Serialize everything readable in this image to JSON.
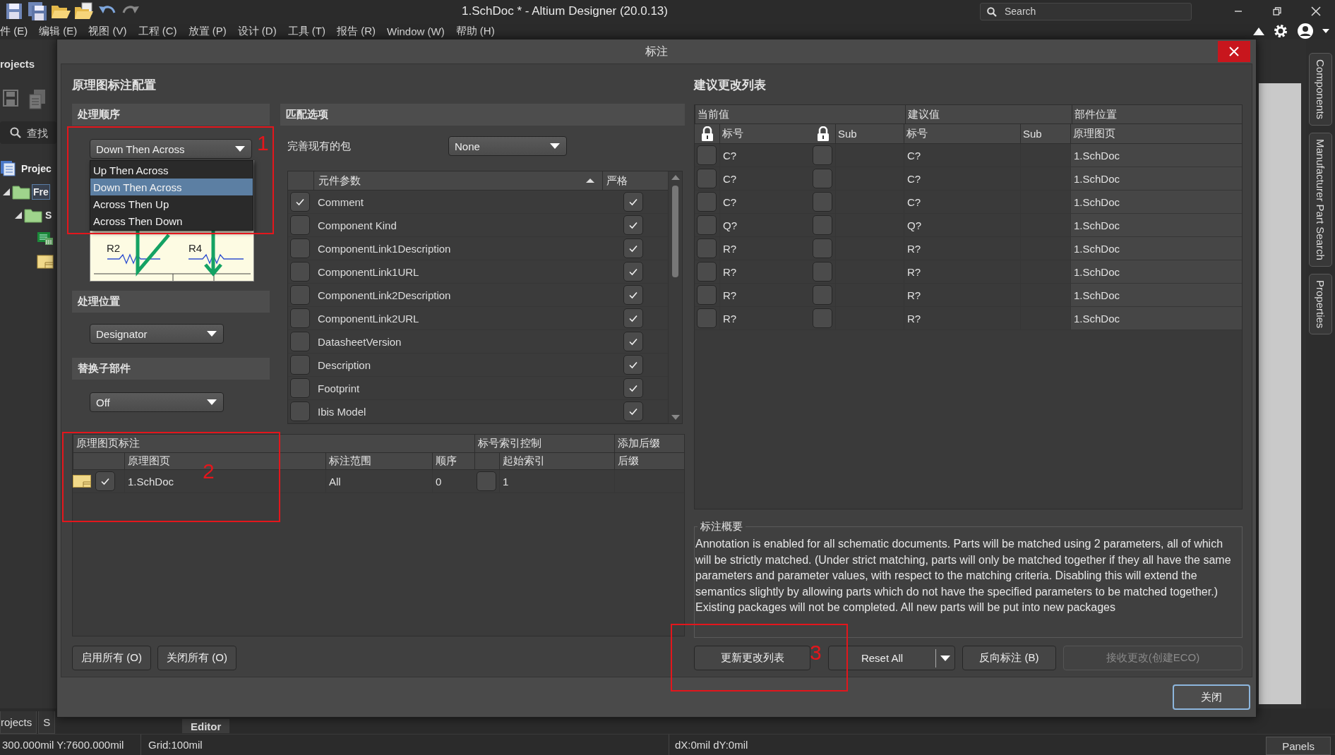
{
  "window": {
    "title": "1.SchDoc * - Altium Designer (20.0.13)",
    "search": {
      "placeholder": "Search"
    }
  },
  "menu": [
    "件 (E)",
    "编辑 (E)",
    "视图 (V)",
    "工程 (C)",
    "放置 (P)",
    "设计 (D)",
    "工具 (T)",
    "报告 (R)",
    "Window (W)",
    "帮助 (H)"
  ],
  "projects_panel": {
    "title": "rojects",
    "search": {
      "placeholder": "查找"
    },
    "tree": [
      {
        "kind": "project",
        "label": "Projec",
        "selected": false,
        "children": [
          {
            "kind": "folder",
            "label": "Fre",
            "selected": true,
            "expanded": true,
            "children": [
              {
                "kind": "folder",
                "label": "S",
                "selected": false,
                "expanded": true,
                "children": [
                  {
                    "kind": "pcb_document",
                    "selected": false
                  },
                  {
                    "kind": "schematic_document",
                    "selected": false
                  }
                ]
              }
            ]
          }
        ]
      }
    ]
  },
  "dialog": {
    "title": "标注",
    "config": {
      "title": "原理图标注配置",
      "order": {
        "title": "处理顺序",
        "value": "Down Then Across",
        "options": [
          {
            "label": "Up Then Across",
            "selected": false
          },
          {
            "label": "Down Then Across",
            "selected": true
          },
          {
            "label": "Across Then Up",
            "selected": false
          },
          {
            "label": "Across Then Down",
            "selected": false
          }
        ],
        "preview": {
          "labels": [
            "R2",
            "R4"
          ]
        }
      },
      "location": {
        "title": "处理位置",
        "value": "Designator"
      },
      "replace": {
        "title": "替换子部件",
        "value": "Off"
      }
    },
    "matching": {
      "title": "匹配选项",
      "complete_label": "完善现有的包",
      "complete_value": "None",
      "columns": [
        "元件参数",
        "严格"
      ],
      "rows": [
        {
          "name": "Comment",
          "checked": true,
          "strict": true
        },
        {
          "name": "Component Kind",
          "checked": false,
          "strict": true
        },
        {
          "name": "ComponentLink1Description",
          "checked": false,
          "strict": true
        },
        {
          "name": "ComponentLink1URL",
          "checked": false,
          "strict": true
        },
        {
          "name": "ComponentLink2Description",
          "checked": false,
          "strict": true
        },
        {
          "name": "ComponentLink2URL",
          "checked": false,
          "strict": true
        },
        {
          "name": "DatasheetVersion",
          "checked": false,
          "strict": true
        },
        {
          "name": "Description",
          "checked": false,
          "strict": true
        },
        {
          "name": "Footprint",
          "checked": false,
          "strict": true
        },
        {
          "name": "Ibis Model",
          "checked": false,
          "strict": true
        }
      ]
    },
    "sheets": {
      "group_headers": [
        "原理图页标注",
        "标号索引控制",
        "添加后缀"
      ],
      "columns": [
        "原理图页",
        "标注范围",
        "顺序",
        "起始索引",
        "后缀"
      ],
      "rows": [
        {
          "enabled": true,
          "sheet": "1.SchDoc",
          "scope": "All",
          "order": "0",
          "index_enabled": false,
          "start_index": "1"
        }
      ]
    },
    "left_buttons": [
      "启用所有 (O)",
      "关闭所有 (O)"
    ],
    "proposed": {
      "title": "建议更改列表",
      "group_headers": [
        "当前值",
        "建议值",
        "部件位置"
      ],
      "columns": [
        "标号",
        "Sub",
        "标号",
        "Sub",
        "原理图页"
      ],
      "rows": [
        {
          "current": "C?",
          "locked": false,
          "sub_locked": false,
          "proposed": "C?",
          "sheet": "1.SchDoc"
        },
        {
          "current": "C?",
          "locked": false,
          "sub_locked": false,
          "proposed": "C?",
          "sheet": "1.SchDoc"
        },
        {
          "current": "C?",
          "locked": false,
          "sub_locked": false,
          "proposed": "C?",
          "sheet": "1.SchDoc"
        },
        {
          "current": "Q?",
          "locked": false,
          "sub_locked": false,
          "proposed": "Q?",
          "sheet": "1.SchDoc"
        },
        {
          "current": "R?",
          "locked": false,
          "sub_locked": false,
          "proposed": "R?",
          "sheet": "1.SchDoc"
        },
        {
          "current": "R?",
          "locked": false,
          "sub_locked": false,
          "proposed": "R?",
          "sheet": "1.SchDoc"
        },
        {
          "current": "R?",
          "locked": false,
          "sub_locked": false,
          "proposed": "R?",
          "sheet": "1.SchDoc"
        },
        {
          "current": "R?",
          "locked": false,
          "sub_locked": false,
          "proposed": "R?",
          "sheet": "1.SchDoc"
        }
      ]
    },
    "summary": {
      "title": "标注概要",
      "text": "Annotation is enabled for all schematic documents. Parts will be matched using 2 parameters, all of which will be strictly matched. (Under strict matching, parts will only be matched together if they all have the same parameters and parameter values, with respect to the matching criteria. Disabling this will extend the semantics slightly by allowing parts which do not have the specified parameters to be matched together.) Existing packages will not be completed. All new parts will be put into new packages"
    },
    "actions": [
      {
        "label": "更新更改列表",
        "kind": "button",
        "disabled": false
      },
      {
        "label": "Reset All",
        "kind": "split",
        "disabled": false
      },
      {
        "label": "反向标注 (B)",
        "kind": "button",
        "disabled": false
      },
      {
        "label": "接收更改(创建ECO)",
        "kind": "button",
        "disabled": true
      }
    ],
    "close": "关闭"
  },
  "right_dock": {
    "tabs": [
      "Components",
      "Manufacturer Part Search",
      "Properties"
    ]
  },
  "bottom_tabs": [
    "rojects",
    "S"
  ],
  "editor_tab": "Editor",
  "status_bar": {
    "position": "300.000mil Y:7600.000mil",
    "grid": "Grid:100mil",
    "delta": "dX:0mil dY:0mil",
    "panels": "Panels"
  },
  "annotations": [
    {
      "label": "1"
    },
    {
      "label": "2"
    },
    {
      "label": "3"
    }
  ]
}
